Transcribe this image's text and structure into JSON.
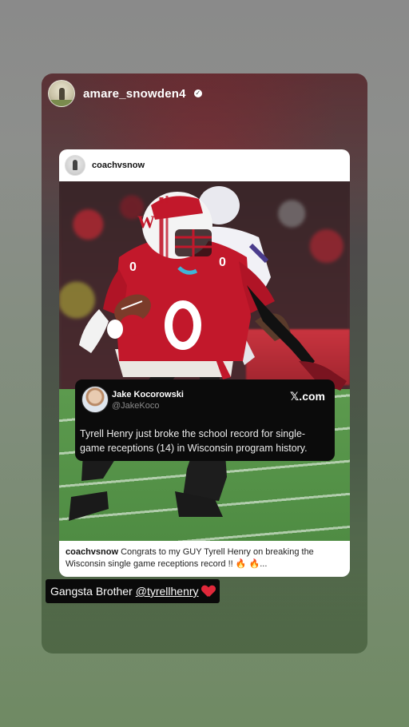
{
  "story": {
    "username": "amare_snowden4",
    "verified_badge": "verified-check-icon"
  },
  "post": {
    "username": "coachvsnow",
    "tweet": {
      "name": "Jake Kocorowski",
      "handle": "@JakeKoco",
      "brand": "𝕏.com",
      "text": "Tyrell Henry just broke the school record for single-game receptions (14) in Wisconsin program history."
    },
    "caption": {
      "author": "coachvsnow",
      "text": "Congrats to my GUY Tyrell Henry on breaking the Wisconsin single game receptions record !! 🔥 🔥..."
    }
  },
  "sticker": {
    "text": "Gangsta Brother",
    "mention": "@tyrellhenry",
    "emoji": "red-heart-icon"
  },
  "colors": {
    "jersey_red": "#c2182b",
    "sticker_bg": "#0a0a0a",
    "heart": "#e0283a"
  }
}
